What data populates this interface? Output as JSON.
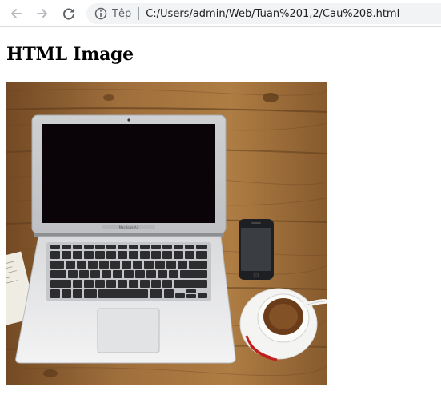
{
  "browser": {
    "back_icon": "arrow-left-icon",
    "forward_icon": "arrow-right-icon",
    "reload_icon": "reload-icon",
    "info_icon": "info-circle-icon",
    "site_chip": "Tệp",
    "url": "C:/Users/admin/Web/Tuan%201,2/Cau%208.html"
  },
  "page": {
    "heading": "HTML Image"
  },
  "image": {
    "subject": "laptop-desk-photo",
    "laptop_brand": "MacBook Air"
  },
  "colors": {
    "toolbar_bg": "#ffffff",
    "omnibox_bg": "#f1f3f4",
    "wood": "#a8753f",
    "screen": "#0a0408"
  }
}
